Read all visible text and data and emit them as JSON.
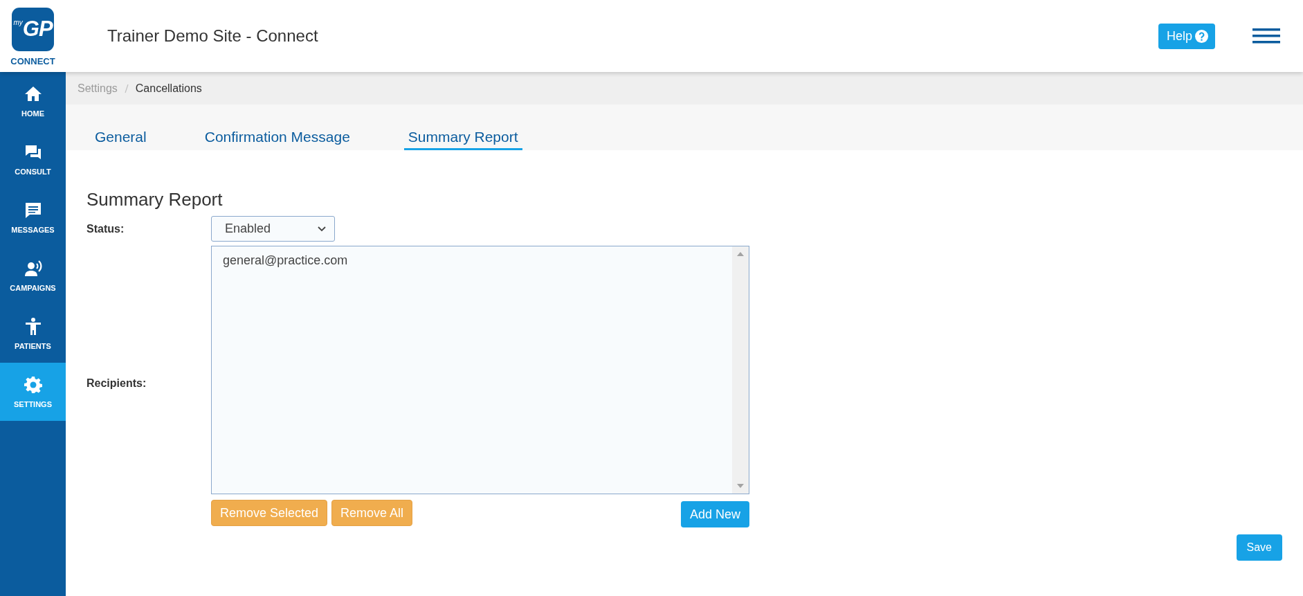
{
  "logo": {
    "superscript": "my",
    "mark": "GP",
    "caption": "CONNECT"
  },
  "header": {
    "title": "Trainer Demo Site - Connect",
    "help_button": "Help"
  },
  "sidebar": {
    "items": [
      {
        "label": "HOME",
        "kind": "home",
        "selected": false
      },
      {
        "label": "CONSULT",
        "kind": "consult",
        "selected": false
      },
      {
        "label": "MESSAGES",
        "kind": "messages",
        "selected": false
      },
      {
        "label": "CAMPAIGNS",
        "kind": "campaigns",
        "selected": false
      },
      {
        "label": "PATIENTS",
        "kind": "patients",
        "selected": false
      },
      {
        "label": "SETTINGS",
        "kind": "settings",
        "selected": true
      }
    ]
  },
  "breadcrumb": [
    {
      "label": "Settings",
      "current": false
    },
    {
      "label": "Cancellations",
      "current": true
    }
  ],
  "tabs": [
    {
      "label": "General",
      "selected": false
    },
    {
      "label": "Confirmation Message",
      "selected": false
    },
    {
      "label": "Summary Report",
      "selected": true
    }
  ],
  "section": {
    "heading": "Summary Report",
    "status": {
      "label": "Status:",
      "value": "Enabled"
    },
    "recipients": {
      "label": "Recipients:",
      "items": [
        {
          "text": "general@practice.com",
          "selected": false
        }
      ]
    },
    "list_buttons": [
      {
        "label": "Remove Selected",
        "kind": "warning"
      },
      {
        "label": "Remove All",
        "kind": "warning"
      },
      {
        "label": "Add New",
        "kind": "primary"
      }
    ],
    "save_button": "Save"
  }
}
